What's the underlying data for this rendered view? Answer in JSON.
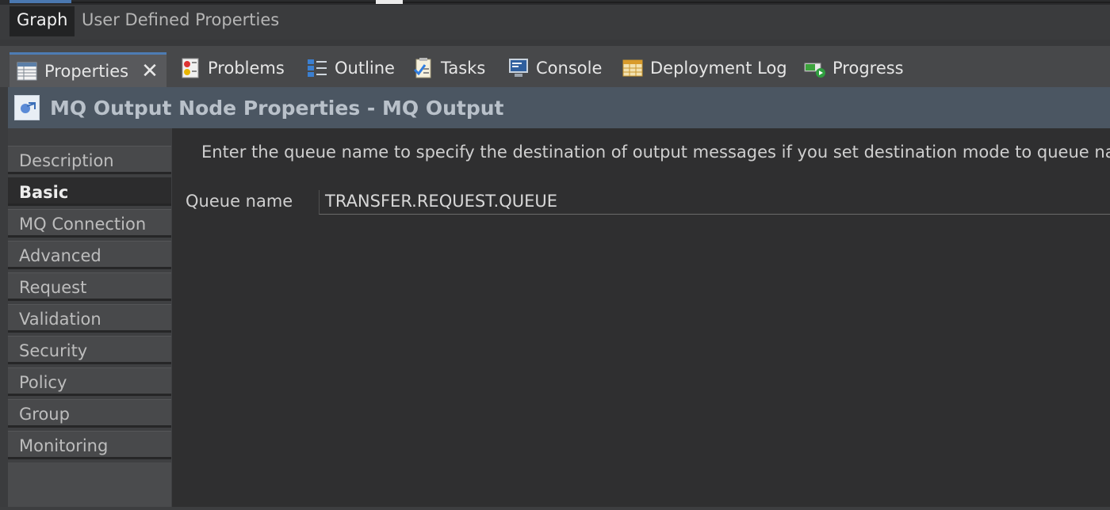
{
  "editor_tabs": {
    "graph": "Graph",
    "user_defined": "User Defined Properties"
  },
  "view_tabs": {
    "properties": "Properties",
    "problems": "Problems",
    "outline": "Outline",
    "tasks": "Tasks",
    "console": "Console",
    "deployment_log": "Deployment Log",
    "progress": "Progress",
    "close_glyph": "✕"
  },
  "header": {
    "title": "MQ Output Node Properties - MQ Output"
  },
  "sidebar": {
    "items": [
      {
        "label": "Description"
      },
      {
        "label": "Basic"
      },
      {
        "label": "MQ Connection"
      },
      {
        "label": "Advanced"
      },
      {
        "label": "Request"
      },
      {
        "label": "Validation"
      },
      {
        "label": "Security"
      },
      {
        "label": "Policy"
      },
      {
        "label": "Group"
      },
      {
        "label": "Monitoring"
      }
    ],
    "selected": "Basic"
  },
  "content": {
    "description": "Enter the queue name to specify the destination of output messages if you set destination mode to queue nar",
    "queue_label": "Queue name",
    "queue_value": "TRANSFER.REQUEST.QUEUE"
  },
  "colors": {
    "accent": "#4d7cb3",
    "header_bg": "#4b5662",
    "content_bg": "#2f2f30"
  }
}
